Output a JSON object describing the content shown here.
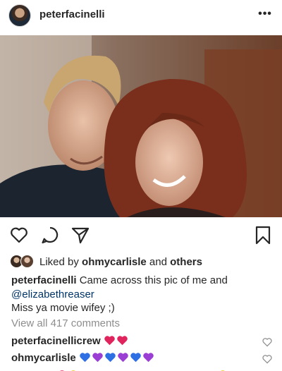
{
  "header": {
    "username": "peterfacinelli",
    "more_label": "•••"
  },
  "photo": {
    "icon": "photo"
  },
  "actions": {
    "like_icon": "heart-outline",
    "comment_icon": "comment-bubble",
    "share_icon": "paper-plane",
    "save_icon": "bookmark"
  },
  "likes": {
    "prefix": "Liked by ",
    "user": "ohmycarlisle",
    "middle": " and ",
    "others": "others"
  },
  "caption": {
    "username": "peterfacinelli",
    "text": " Came across this pic of me and",
    "mention": "@elizabethreaser",
    "line2": "Miss ya movie wifey ;)"
  },
  "view_all": "View all 417 comments",
  "comments": [
    {
      "username": "peterfacinellicrew",
      "emojis": [
        "red-heart",
        "red-heart"
      ],
      "colors": [
        "#e0245e",
        "#e0245e"
      ]
    },
    {
      "username": "ohmycarlisle",
      "emojis": [
        "blue-heart",
        "purple-heart",
        "blue-heart",
        "purple-heart",
        "blue-heart",
        "purple-heart"
      ],
      "colors": [
        "#2f6fe4",
        "#9b3fd4",
        "#2f6fe4",
        "#9b3fd4",
        "#2f6fe4",
        "#9b3fd4"
      ]
    }
  ],
  "colors": {
    "text": "#262626",
    "muted": "#8e8e8e",
    "link": "#003569"
  }
}
